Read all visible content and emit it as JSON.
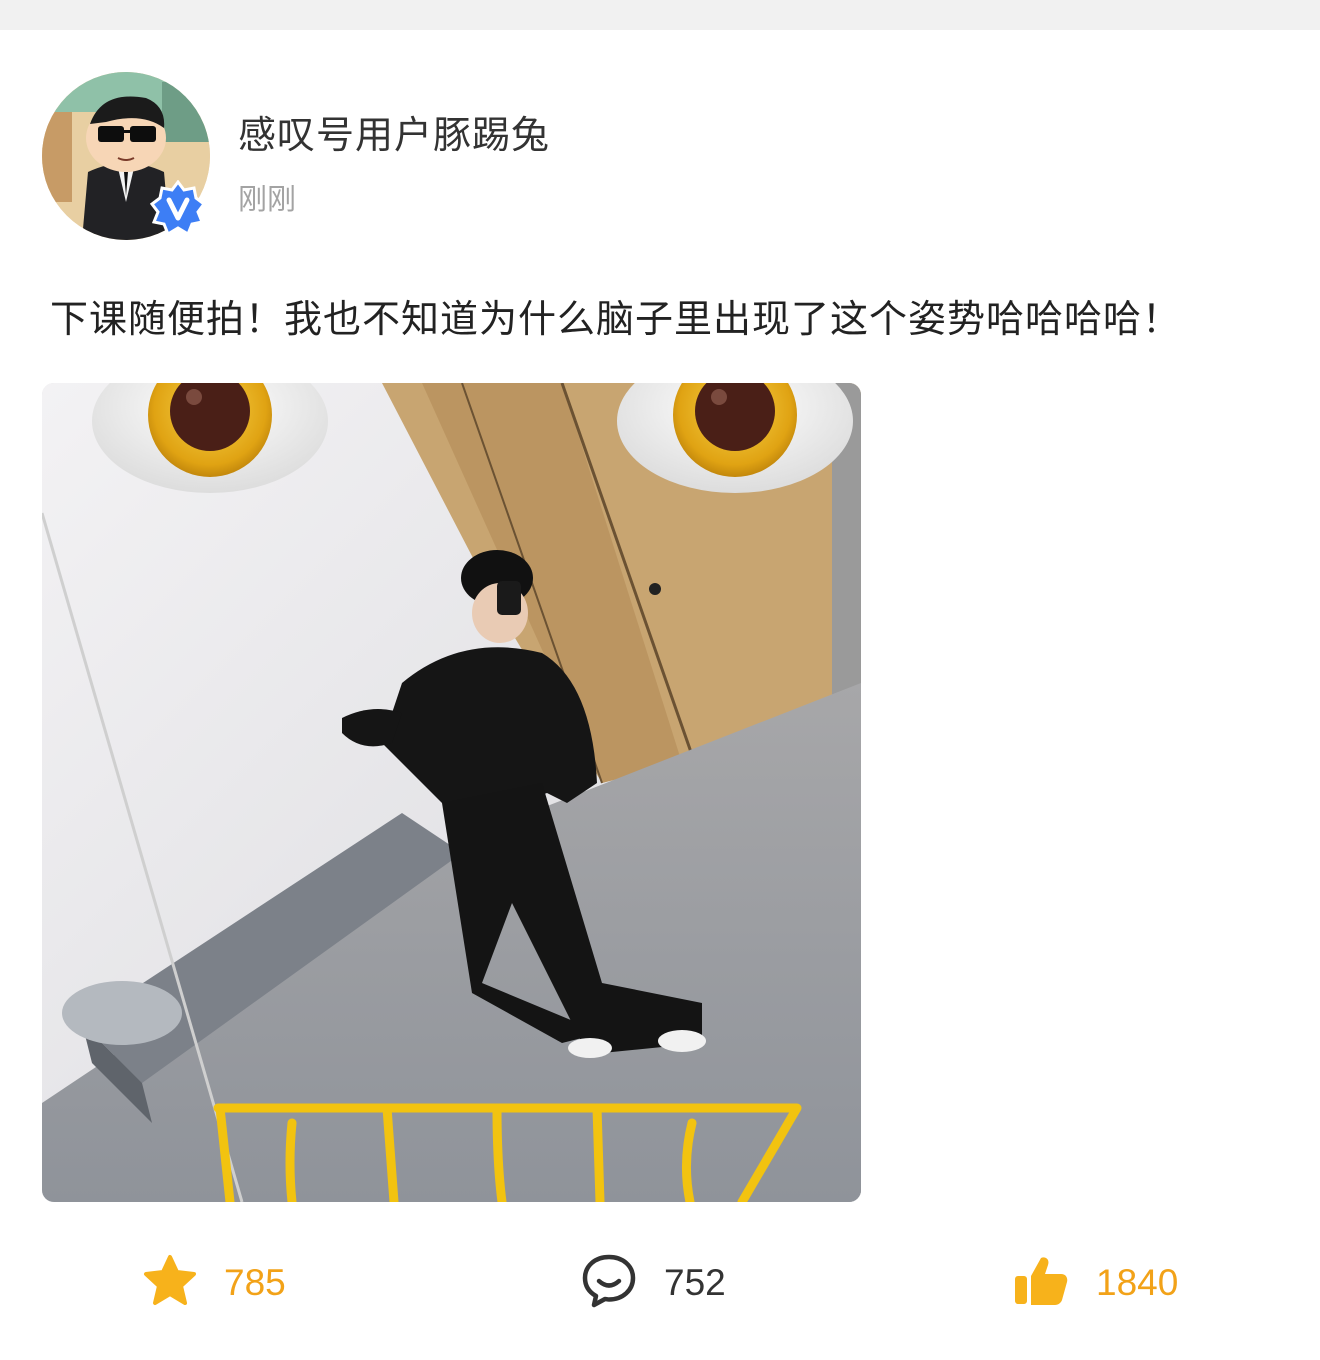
{
  "post": {
    "author": {
      "name": "感叹号用户豚踢兔",
      "avatar_icon": "cartoon-boy-suit-avatar",
      "verified_icon": "verified-v-badge-icon",
      "verified_color": "#3d7ef5"
    },
    "time": "刚刚",
    "text": "下课随便拍！我也不知道为什么脑子里出现了这个姿势哈哈哈哈！",
    "image": {
      "description_icon": "mirror-selfie-photo"
    }
  },
  "actions": {
    "favorite": {
      "icon": "star-icon",
      "count": "785",
      "color": "#f2a218"
    },
    "comment": {
      "icon": "comment-bubble-icon",
      "count": "752",
      "color": "#333333"
    },
    "like": {
      "icon": "thumbs-up-icon",
      "count": "1840",
      "color": "#f2a218"
    }
  }
}
